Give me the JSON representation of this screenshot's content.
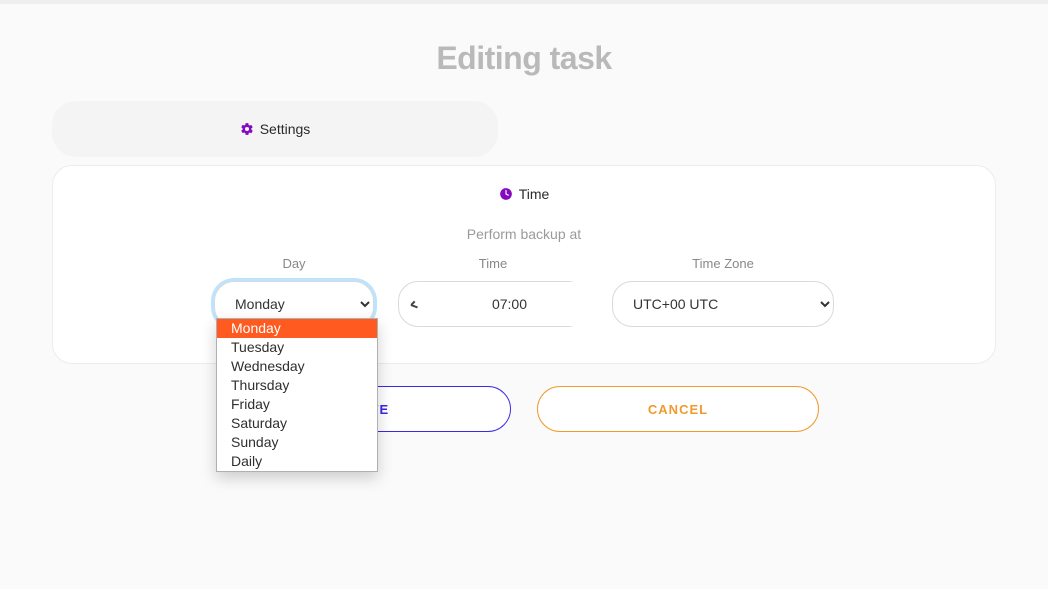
{
  "page": {
    "title": "Editing task"
  },
  "tab": {
    "label": "Settings"
  },
  "section": {
    "title": "Time",
    "subtitle": "Perform backup at"
  },
  "labels": {
    "day": "Day",
    "time": "Time",
    "timezone": "Time Zone"
  },
  "form": {
    "day_selected": "Monday",
    "time_value": "07:00",
    "timezone_selected": "UTC+00 UTC",
    "day_options": [
      "Monday",
      "Tuesday",
      "Wednesday",
      "Thursday",
      "Friday",
      "Saturday",
      "Sunday",
      "Daily"
    ]
  },
  "buttons": {
    "save": "SAVE",
    "cancel": "CANCEL"
  },
  "colors": {
    "accent_purple": "#8409c0",
    "save_blue": "#3b27e6",
    "cancel_orange": "#f29a2e",
    "option_highlight": "#ff5a1f"
  }
}
